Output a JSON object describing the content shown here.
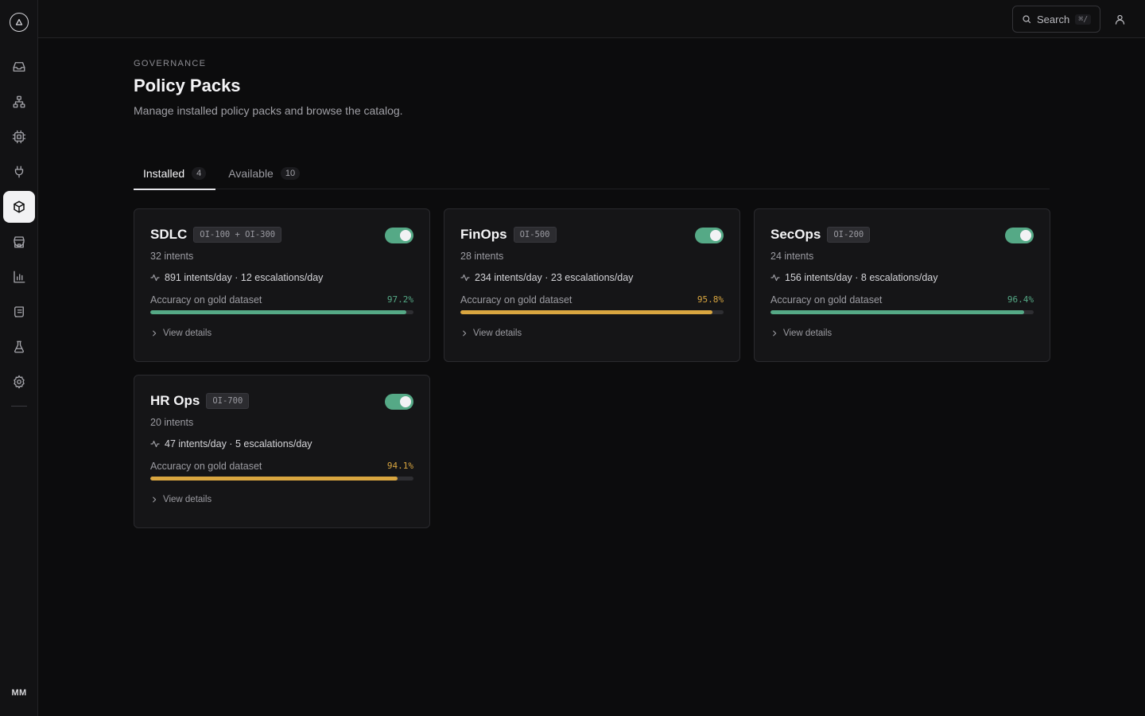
{
  "sidebar": {
    "items": [
      {
        "name": "inbox-icon",
        "active": false
      },
      {
        "name": "hierarchy-icon",
        "active": false
      },
      {
        "name": "chip-icon",
        "active": false
      },
      {
        "name": "plug-icon",
        "active": false
      },
      {
        "name": "package-icon",
        "active": true
      },
      {
        "name": "store-icon",
        "active": false
      },
      {
        "name": "bar-chart-icon",
        "active": false
      },
      {
        "name": "scroll-icon",
        "active": false
      },
      {
        "name": "flask-icon",
        "active": false
      },
      {
        "name": "gear-icon",
        "active": false
      }
    ],
    "avatar_initials": "MM"
  },
  "topbar": {
    "search_label": "Search",
    "search_shortcut": "⌘/"
  },
  "page": {
    "eyebrow": "GOVERNANCE",
    "title": "Policy Packs",
    "subtitle": "Manage installed policy packs and browse the catalog."
  },
  "tabs": [
    {
      "label": "Installed",
      "count": "4",
      "active": true
    },
    {
      "label": "Available",
      "count": "10",
      "active": false
    }
  ],
  "colors": {
    "green": "#55a986",
    "amber": "#d9a640"
  },
  "cards": [
    {
      "name": "SDLC",
      "code": "OI-100 + OI-300",
      "enabled": true,
      "intents": "32 intents",
      "rate": "891 intents/day · 12 escalations/day",
      "accuracy_label": "Accuracy on gold dataset",
      "accuracy": "97.2%",
      "accuracy_value": 97.2,
      "status": "green",
      "details": "View details"
    },
    {
      "name": "FinOps",
      "code": "OI-500",
      "enabled": true,
      "intents": "28 intents",
      "rate": "234 intents/day · 23 escalations/day",
      "accuracy_label": "Accuracy on gold dataset",
      "accuracy": "95.8%",
      "accuracy_value": 95.8,
      "status": "amber",
      "details": "View details"
    },
    {
      "name": "SecOps",
      "code": "OI-200",
      "enabled": true,
      "intents": "24 intents",
      "rate": "156 intents/day · 8 escalations/day",
      "accuracy_label": "Accuracy on gold dataset",
      "accuracy": "96.4%",
      "accuracy_value": 96.4,
      "status": "green",
      "details": "View details"
    },
    {
      "name": "HR Ops",
      "code": "OI-700",
      "enabled": true,
      "intents": "20 intents",
      "rate": "47 intents/day · 5 escalations/day",
      "accuracy_label": "Accuracy on gold dataset",
      "accuracy": "94.1%",
      "accuracy_value": 94.1,
      "status": "amber",
      "details": "View details"
    }
  ]
}
